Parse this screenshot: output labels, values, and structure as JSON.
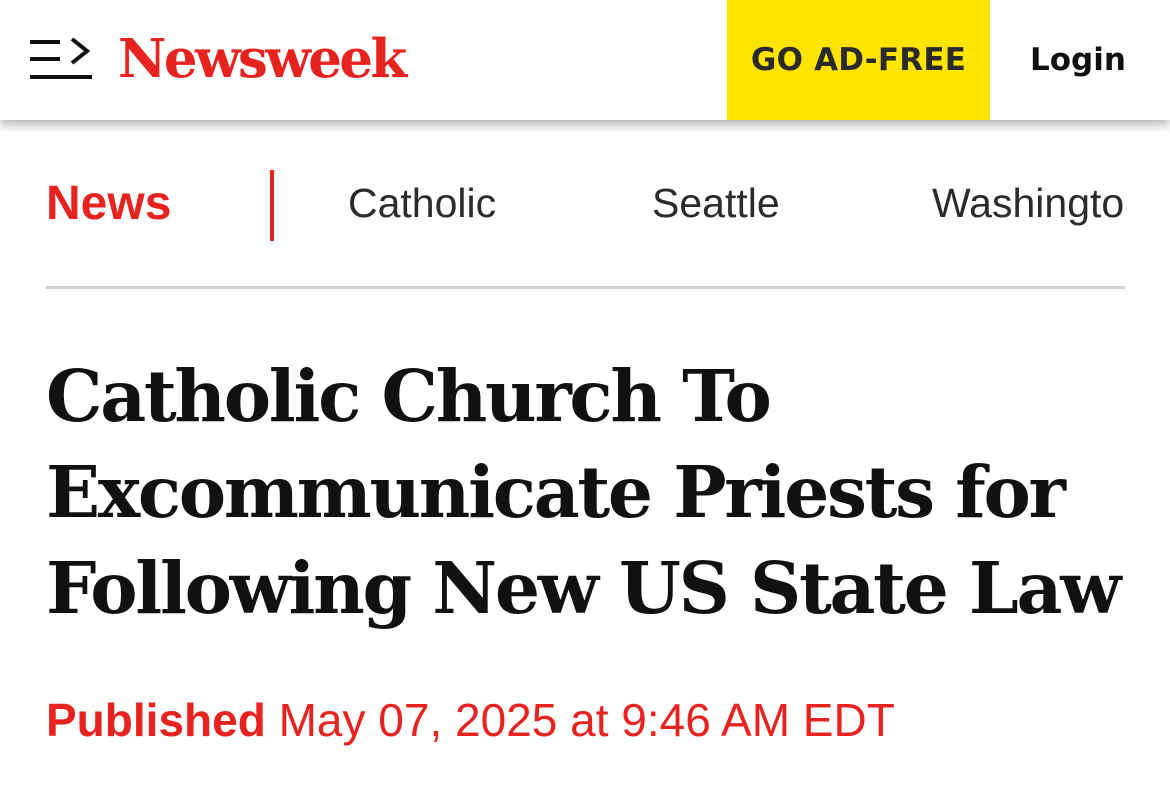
{
  "header": {
    "menu_icon": "menu-expand-icon",
    "logo_text": "Newsweek",
    "ad_free_label": "GO AD-FREE",
    "login_label": "Login"
  },
  "topic_nav": {
    "section_label": "News",
    "links": [
      "Catholic",
      "Seattle",
      "Washington"
    ]
  },
  "article": {
    "headline": "Catholic Church To Excommunicate Priests for Following New US State Law",
    "published_label": "Published",
    "published_date": "May 07, 2025 at 9:46 AM EDT"
  },
  "colors": {
    "brand_red": "#e7231f",
    "ad_free_yellow": "#ffe400",
    "divider_gray": "#cfcfcf"
  }
}
